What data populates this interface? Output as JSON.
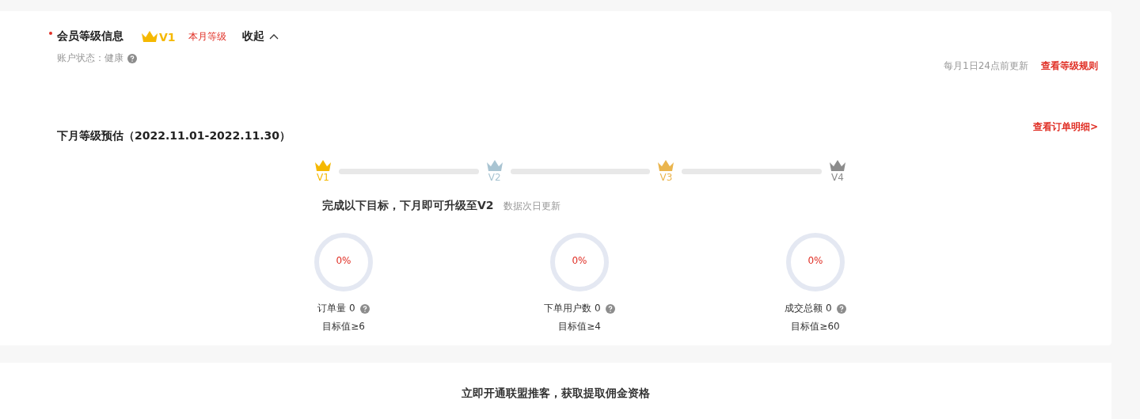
{
  "header": {
    "title": "会员等级信息",
    "current_level": "V1",
    "month_label": "本月等级",
    "collapse": "收起",
    "expanded": true
  },
  "account": {
    "label": "账户状态：",
    "value": "健康"
  },
  "update_note": "每月1日24点前更新",
  "rules_link": "查看等级规则",
  "forecast": {
    "title": "下月等级预估（2022.11.01-2022.11.30）",
    "detail_link": "查看订单明细>"
  },
  "levels": [
    {
      "label": "V1",
      "color": "#f5b800"
    },
    {
      "label": "V2",
      "color": "#a9c4d2"
    },
    {
      "label": "V3",
      "color": "#eab54e"
    },
    {
      "label": "V4",
      "color": "#8c8c8c"
    }
  ],
  "goal": {
    "text": "完成以下目标，下月即可升级至V2",
    "note": "数据次日更新"
  },
  "metrics": [
    {
      "percent": "0%",
      "name": "订单量 0",
      "target": "目标值≥6"
    },
    {
      "percent": "0%",
      "name": "下单用户数 0",
      "target": "目标值≥4"
    },
    {
      "percent": "0%",
      "name": "成交总额 0",
      "target": "目标值≥60"
    }
  ],
  "promo": "立即开通联盟推客，获取提取佣金资格"
}
